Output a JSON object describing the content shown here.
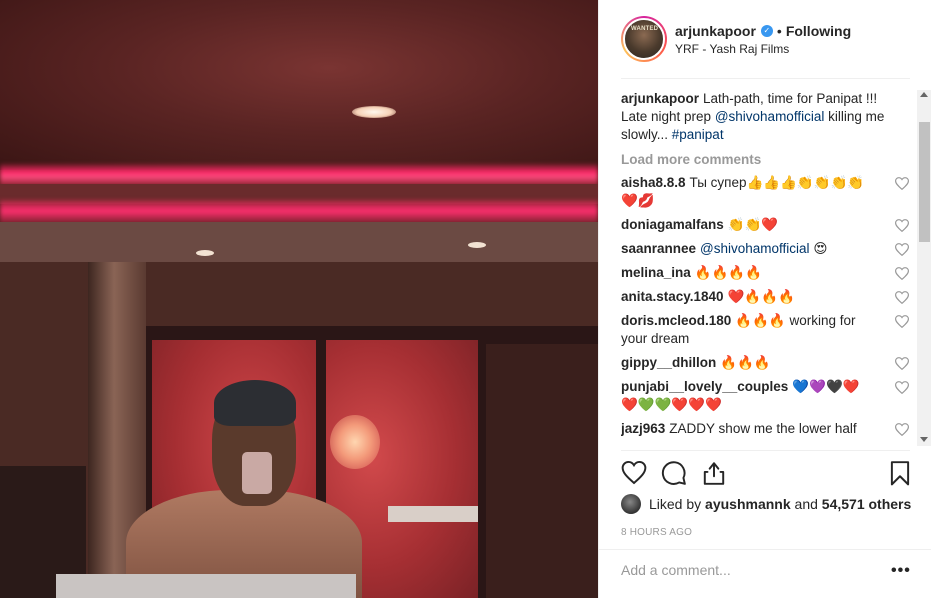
{
  "post": {
    "username": "arjunkapoor",
    "dot": "•",
    "follow_state": "Following",
    "location": "YRF - Yash Raj Films",
    "avatar_text": "WANTED"
  },
  "caption": {
    "user": "arjunkapoor",
    "text_1": "Lath-path, time for Panipat !!! Late night prep ",
    "mention": "@shivohamofficial",
    "text_2": " killing me slowly... ",
    "hashtag": "#panipat"
  },
  "load_more": "Load more comments",
  "comments": [
    {
      "user": "aisha8.8.8",
      "text": "Ты супер👍👍👍👏👏👏👏❤️💋"
    },
    {
      "user": "doniagamalfans",
      "text": "👏👏❤️"
    },
    {
      "user": "saanrannee",
      "mention": "@shivohamofficial",
      "text": " 😍"
    },
    {
      "user": "melina_ina",
      "text": "🔥🔥🔥🔥"
    },
    {
      "user": "anita.stacy.1840",
      "text": "❤️🔥🔥🔥"
    },
    {
      "user": "doris.mcleod.180",
      "text": "🔥🔥🔥 working for your dream"
    },
    {
      "user": "gippy__dhillon",
      "text": "🔥🔥🔥"
    },
    {
      "user": "punjabi__lovely__couples",
      "text": "💙💜🖤❤️❤️💚💚❤️❤️❤️"
    },
    {
      "user": "jazj963",
      "text": "ZADDY show me the lower half"
    }
  ],
  "likes": {
    "prefix": "Liked by ",
    "user": "ayushmannk",
    "middle": " and ",
    "count": "54,571 others"
  },
  "timestamp": "8 HOURS AGO",
  "add_comment": {
    "placeholder": "Add a comment...",
    "more": "•••"
  },
  "colors": {
    "link": "#003569",
    "verified": "#3897f0",
    "muted": "#999999"
  },
  "icons": [
    "heart-icon",
    "comment-icon",
    "share-icon",
    "bookmark-icon",
    "verified-icon",
    "more-options-icon"
  ]
}
